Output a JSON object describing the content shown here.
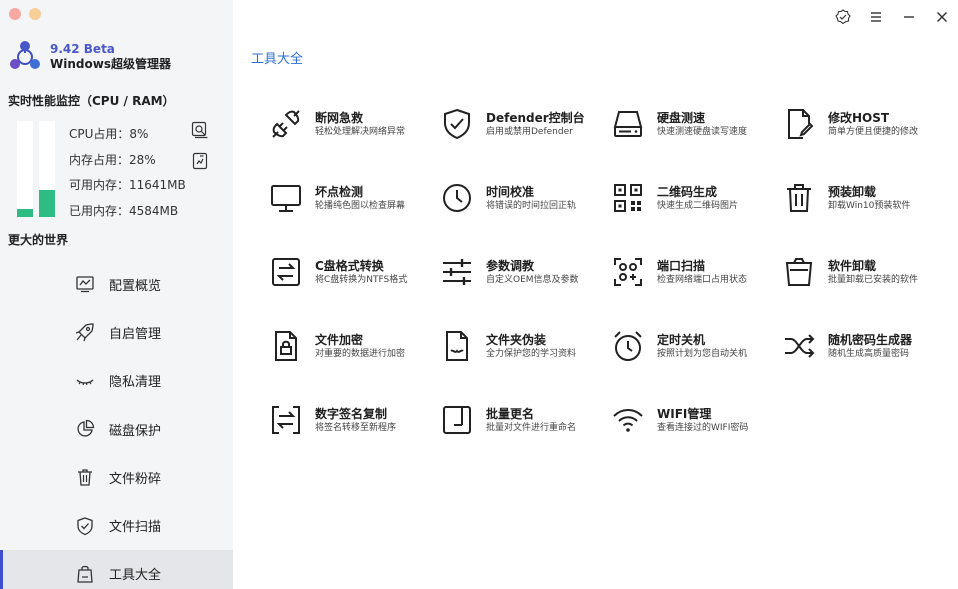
{
  "brand": {
    "version": "9.42 Beta",
    "name": "Windows超级管理器"
  },
  "monitor": {
    "title": "实时性能监控（CPU / RAM）",
    "cpu_fraction": 0.08,
    "ram_fraction": 0.28,
    "cpu_label": "CPU占用：8%",
    "mem_label": "内存占用：28%",
    "avail_label": "可用内存：11641MB",
    "used_label": "已用内存：4584MB",
    "accent": "#2fbb84"
  },
  "world_label": "更大的世界",
  "sidebar": {
    "items": [
      {
        "label": "配置概览",
        "icon": "chart-icon"
      },
      {
        "label": "自启管理",
        "icon": "rocket-icon"
      },
      {
        "label": "隐私清理",
        "icon": "eye-closed-icon"
      },
      {
        "label": "磁盘保护",
        "icon": "pie-icon"
      },
      {
        "label": "文件粉碎",
        "icon": "trash-icon"
      },
      {
        "label": "文件扫描",
        "icon": "shield-check-icon"
      },
      {
        "label": "工具大全",
        "icon": "bag-icon",
        "active": true
      }
    ]
  },
  "main": {
    "title": "工具大全",
    "accent": "#2f6fd6",
    "tools": [
      {
        "name": "断网急救",
        "desc": "轻松处理解决网络异常",
        "icon": "plug-icon"
      },
      {
        "name": "Defender控制台",
        "desc": "启用或禁用Defender",
        "icon": "shield-check-icon"
      },
      {
        "name": "硬盘测速",
        "desc": "快速测速硬盘读写速度",
        "icon": "hdd-icon"
      },
      {
        "name": "修改HOST",
        "desc": "简单方便且便捷的修改",
        "icon": "file-edit-icon"
      },
      {
        "name": "坏点检测",
        "desc": "轮播纯色图以检查屏幕",
        "icon": "monitor-icon"
      },
      {
        "name": "时间校准",
        "desc": "将错误的时间拉回正轨",
        "icon": "clock-icon"
      },
      {
        "name": "二维码生成",
        "desc": "快速生成二维码图片",
        "icon": "qrcode-icon"
      },
      {
        "name": "预装卸载",
        "desc": "卸载Win10预装软件",
        "icon": "trash-icon"
      },
      {
        "name": "C盘格式转换",
        "desc": "将C盘转换为NTFS格式",
        "icon": "swap-box-icon"
      },
      {
        "name": "参数调教",
        "desc": "自定义OEM信息及参数",
        "icon": "sliders-icon"
      },
      {
        "name": "端口扫描",
        "desc": "检查网络端口占用状态",
        "icon": "scan-nodes-icon"
      },
      {
        "name": "软件卸载",
        "desc": "批量卸载已安装的软件",
        "icon": "bin-icon"
      },
      {
        "name": "文件加密",
        "desc": "对重要的数据进行加密",
        "icon": "file-lock-icon"
      },
      {
        "name": "文件夹伪装",
        "desc": "全力保护您的学习资料",
        "icon": "file-mask-icon"
      },
      {
        "name": "定时关机",
        "desc": "按照计划为您自动关机",
        "icon": "alarm-clock-icon"
      },
      {
        "name": "随机密码生成器",
        "desc": "随机生成高质量密码",
        "icon": "shuffle-icon"
      },
      {
        "name": "数字签名复制",
        "desc": "将签名转移至新程序",
        "icon": "transfer-icon"
      },
      {
        "name": "批量更名",
        "desc": "批量对文件进行重命名",
        "icon": "rename-icon"
      },
      {
        "name": "WIFI管理",
        "desc": "查看连接过的WIFI密码",
        "icon": "wifi-icon"
      }
    ]
  }
}
